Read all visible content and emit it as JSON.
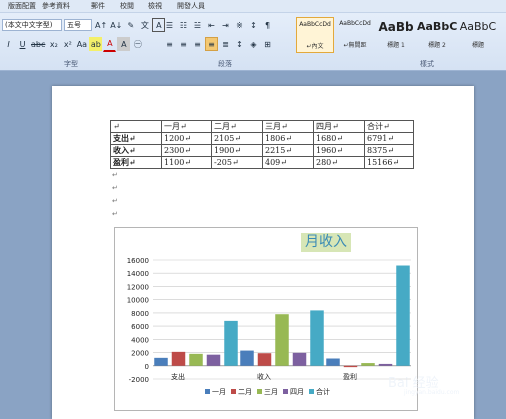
{
  "menu": [
    "版面配置",
    "參考資料",
    "郵件",
    "校閱",
    "檢視",
    "開發人員"
  ],
  "font": {
    "name": "(本文中文字型)",
    "size": "五号"
  },
  "groups": {
    "font": "字型",
    "paragraph": "段落",
    "styles": "樣式"
  },
  "styles": [
    {
      "preview": "AaBbCcDd",
      "name": "↵內文",
      "selected": true
    },
    {
      "preview": "AaBbCcDd",
      "name": "↵無間距",
      "selected": false
    },
    {
      "preview": "AaBb",
      "name": "標題 1",
      "selected": false
    },
    {
      "preview": "AaBbC",
      "name": "標題 2",
      "selected": false
    },
    {
      "preview": "AaBbC",
      "name": "標題",
      "selected": false
    }
  ],
  "table": {
    "header": [
      "↵",
      "一月↵",
      "二月↵",
      "三月↵",
      "四月↵",
      "合计↵"
    ],
    "rows": [
      [
        "支出↵",
        "1200↵",
        "2105↵",
        "1806↵",
        "1680↵",
        "6791↵"
      ],
      [
        "收入↵",
        "2300↵",
        "1900↵",
        "2215↵",
        "1960↵",
        "8375↵"
      ],
      [
        "盈利↵",
        "1100↵",
        "-205↵",
        "409↵",
        "280↵",
        "15166↵"
      ]
    ]
  },
  "chart_data": {
    "type": "bar",
    "title": "月收入",
    "categories": [
      "支出",
      "收入",
      "盈利"
    ],
    "series": [
      {
        "name": "一月",
        "values": [
          1200,
          2300,
          1100
        ]
      },
      {
        "name": "二月",
        "values": [
          2105,
          1900,
          -205
        ]
      },
      {
        "name": "三月",
        "values": [
          1806,
          7800,
          409
        ]
      },
      {
        "name": "四月",
        "values": [
          1680,
          1960,
          280
        ]
      },
      {
        "name": "合计",
        "values": [
          6791,
          8375,
          15166
        ]
      }
    ],
    "ylim": [
      -2000,
      16000
    ],
    "yticks": [
      "16000",
      "14000",
      "12000",
      "10000",
      "8000",
      "6000",
      "4000",
      "2000",
      "0",
      "-2000"
    ],
    "grid": true,
    "legend": "bottom"
  },
  "colors": {
    "s0": "#4a7ebb",
    "s1": "#be4b48",
    "s2": "#98b954",
    "s3": "#7d60a0",
    "s4": "#46aac5"
  },
  "watermark": {
    "brand": "Bai 经验",
    "sub": "jingyan.baidu.com"
  }
}
